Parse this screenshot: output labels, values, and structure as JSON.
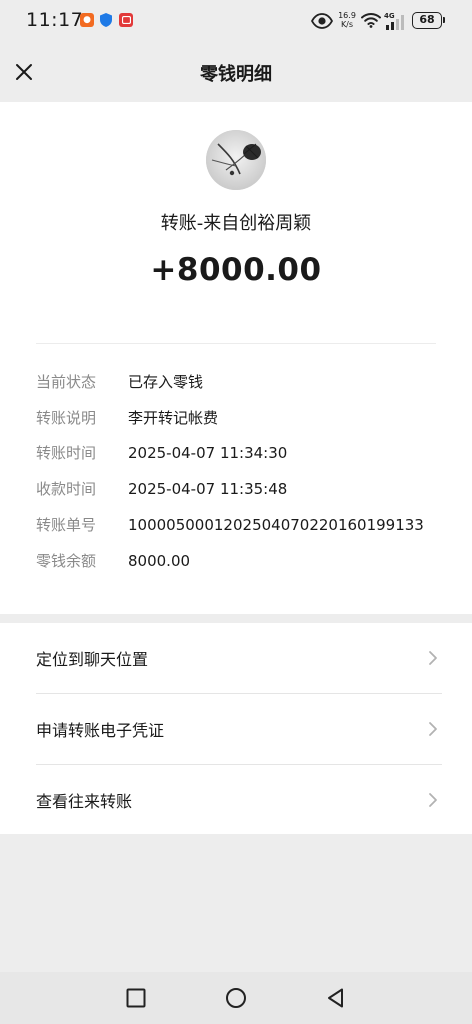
{
  "status_bar": {
    "time": "11:17",
    "net_speed_value": "16.9",
    "net_speed_unit": "K/s",
    "network_type": "4G",
    "battery": "68"
  },
  "header": {
    "title": "零钱明细"
  },
  "transfer": {
    "sender_line": "转账-来自创裕周颖",
    "amount": "+8000.00"
  },
  "details": [
    {
      "label": "当前状态",
      "value": "已存入零钱"
    },
    {
      "label": "转账说明",
      "value": "李开转记帐费"
    },
    {
      "label": "转账时间",
      "value": "2025-04-07 11:34:30"
    },
    {
      "label": "收款时间",
      "value": "2025-04-07 11:35:48"
    },
    {
      "label": "转账单号",
      "value": "1000050001202504070220160199133"
    },
    {
      "label": "零钱余额",
      "value": "8000.00"
    }
  ],
  "actions": [
    {
      "label": "定位到聊天位置",
      "icon": "chevron-right-icon"
    },
    {
      "label": "申请转账电子凭证",
      "icon": "chevron-right-icon"
    },
    {
      "label": "查看往来转账",
      "icon": "chevron-right-icon"
    }
  ],
  "icons": {
    "close": "close-icon",
    "eye": "eye-icon",
    "wifi": "wifi-icon",
    "signal": "signal-icon",
    "nav_recent": "square-icon",
    "nav_home": "circle-icon",
    "nav_back": "triangle-back-icon"
  },
  "colors": {
    "page_background": "#ededed",
    "card_background": "#ffffff",
    "label_gray": "#8a8a8a",
    "text_dark": "#1a1a1a"
  }
}
